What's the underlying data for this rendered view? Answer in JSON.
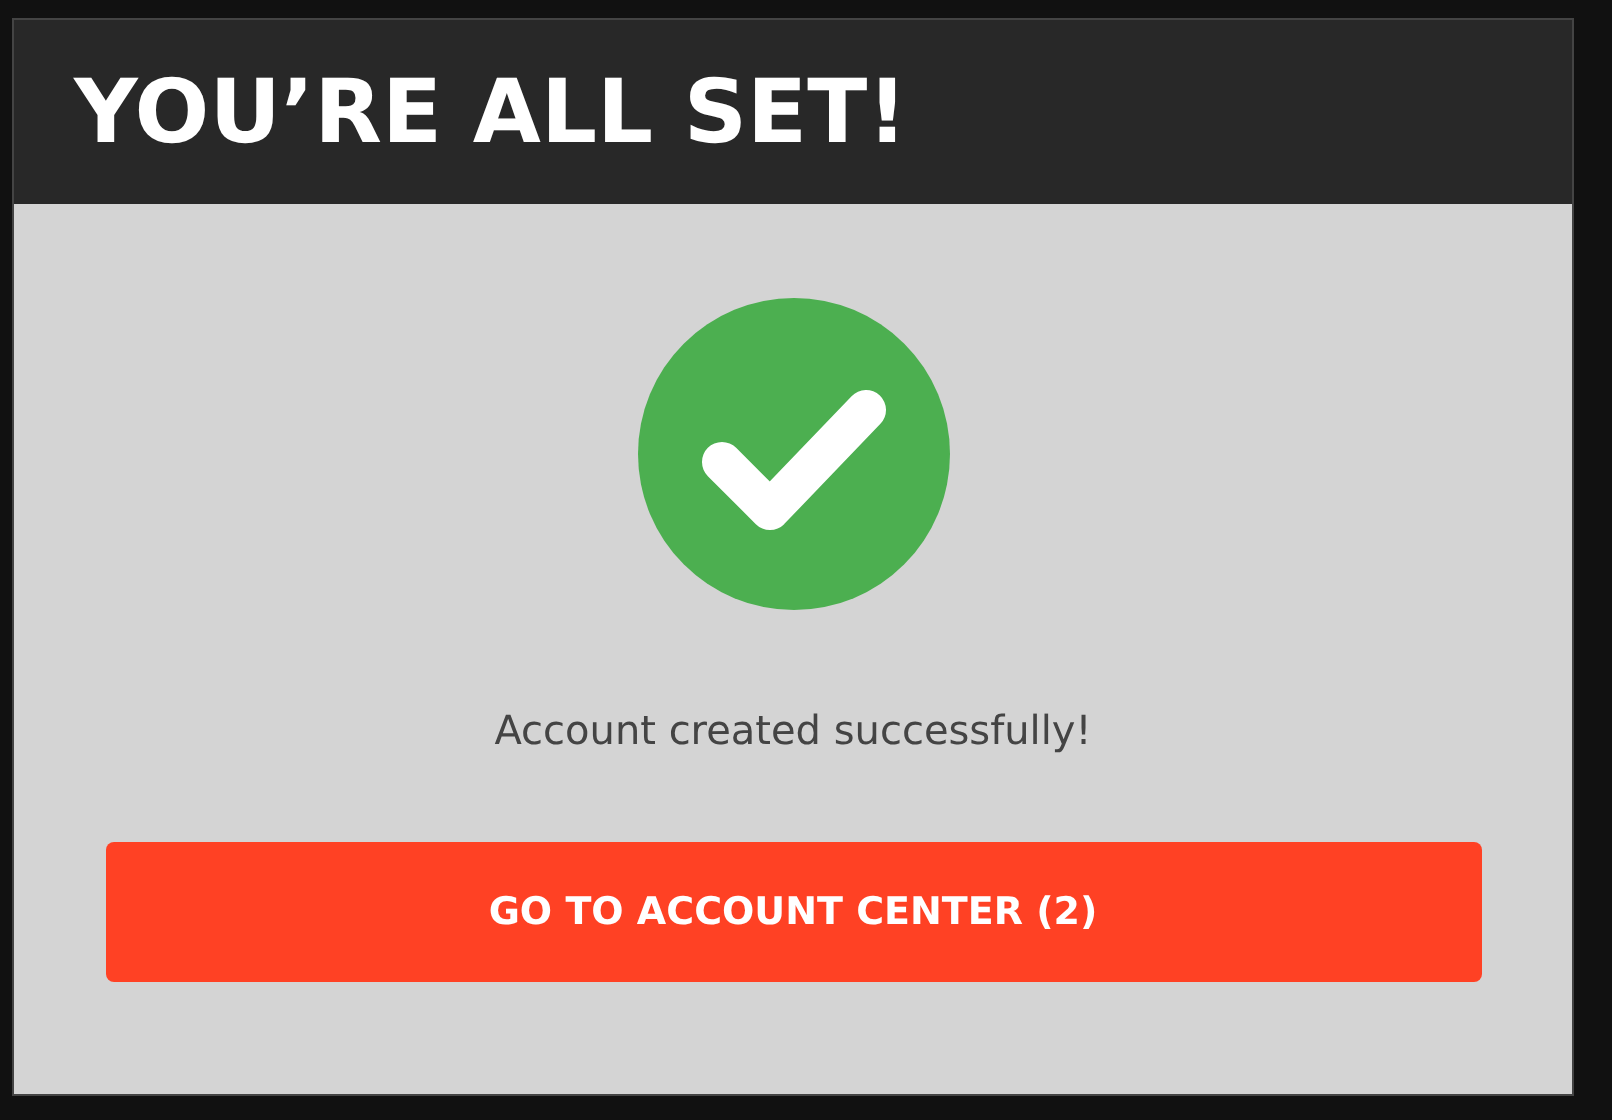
{
  "dialog": {
    "title": "YOU’RE ALL SET!",
    "message": "Account created successfully!",
    "button": "GO TO ACCOUNT CENTER (2)"
  }
}
